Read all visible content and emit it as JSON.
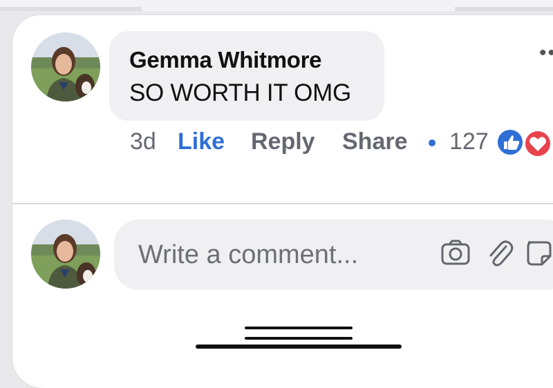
{
  "comment": {
    "author": "Gemma Whitmore",
    "text": "SO WORTH IT OMG",
    "time": "3d",
    "like_label": "Like",
    "reply_label": "Reply",
    "share_label": "Share",
    "reaction_count": "127",
    "reactions": [
      "like-icon",
      "love-icon"
    ]
  },
  "composer": {
    "placeholder": "Write a comment...",
    "icons": [
      "camera-icon",
      "paperclip-icon",
      "sticker-icon"
    ]
  },
  "colors": {
    "accent": "#2f6fd6",
    "love": "#e8434d",
    "bubble": "#f0f0f2"
  }
}
